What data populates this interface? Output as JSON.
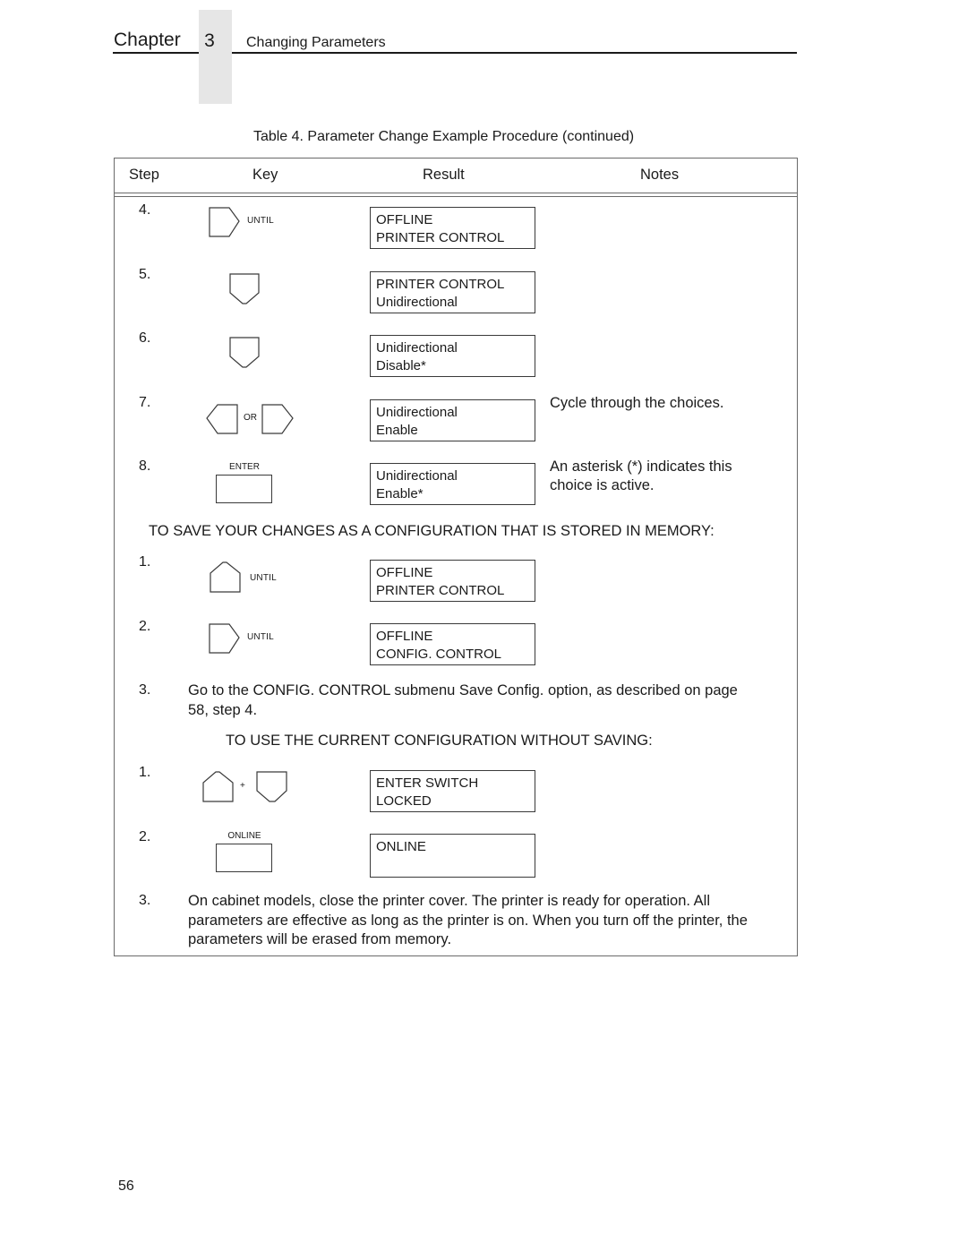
{
  "header": {
    "chapter_word": "Chapter",
    "chapter_number": "3",
    "chapter_title": "Changing Parameters"
  },
  "table": {
    "caption": "Table 4. Parameter Change Example Procedure (continued)",
    "columns": [
      "Step",
      "Key",
      "Result",
      "Notes"
    ],
    "rows": [
      {
        "step": "4.",
        "key": {
          "icons": [
            "right-arrow-key-icon"
          ],
          "label": "UNTIL"
        },
        "result": [
          "OFFLINE",
          "PRINTER CONTROL"
        ],
        "note": ""
      },
      {
        "step": "5.",
        "key": {
          "icons": [
            "down-arrow-key-icon"
          ],
          "label": ""
        },
        "result": [
          "PRINTER CONTROL",
          "Unidirectional"
        ],
        "note": ""
      },
      {
        "step": "6.",
        "key": {
          "icons": [
            "down-arrow-key-icon"
          ],
          "label": ""
        },
        "result": [
          "Unidirectional",
          "Disable*"
        ],
        "note": ""
      },
      {
        "step": "7.",
        "key": {
          "icons": [
            "left-arrow-key-icon",
            "right-arrow-key-icon"
          ],
          "label": "OR"
        },
        "result": [
          "Unidirectional",
          "Enable"
        ],
        "note": "Cycle through the choices."
      },
      {
        "step": "8.",
        "key": {
          "icons": [
            "enter-key-icon"
          ],
          "label": "ENTER"
        },
        "result": [
          "Unidirectional",
          "Enable*"
        ],
        "note": "An asterisk (*) indicates this choice is active."
      }
    ],
    "save_section": {
      "heading": "TO SAVE YOUR CHANGES AS A CONFIGURATION THAT IS STORED IN MEMORY:",
      "rows": [
        {
          "step": "1.",
          "key": {
            "icons": [
              "up-arrow-key-icon"
            ],
            "label": "UNTIL"
          },
          "result": [
            "OFFLINE",
            "PRINTER CONTROL"
          ]
        },
        {
          "step": "2.",
          "key": {
            "icons": [
              "right-arrow-key-icon"
            ],
            "label": "UNTIL"
          },
          "result": [
            "OFFLINE",
            "CONFIG. CONTROL"
          ]
        }
      ],
      "step3": {
        "step": "3.",
        "text_line1": "Go to the CONFIG. CONTROL submenu Save Config. option, as described on page",
        "text_line2": "58, step 4."
      }
    },
    "nosave_section": {
      "heading": "TO USE THE CURRENT CONFIGURATION WITHOUT SAVING:",
      "rows": [
        {
          "step": "1.",
          "key": {
            "icons": [
              "up-arrow-key-icon",
              "down-arrow-key-icon"
            ],
            "label": "+"
          },
          "result": [
            "ENTER SWITCH",
            "LOCKED"
          ]
        },
        {
          "step": "2.",
          "key": {
            "icons": [
              "online-key-icon"
            ],
            "label": "ONLINE"
          },
          "result": [
            "ONLINE",
            ""
          ]
        }
      ],
      "step3": {
        "step": "3.",
        "text_line1": "On cabinet models, close the printer cover. The printer is ready for operation. All",
        "text_line2": "parameters are effective as long as the printer is on. When you turn off the printer, the",
        "text_line3": "parameters will be erased from memory."
      }
    }
  },
  "footer": {
    "page_number": "56"
  }
}
